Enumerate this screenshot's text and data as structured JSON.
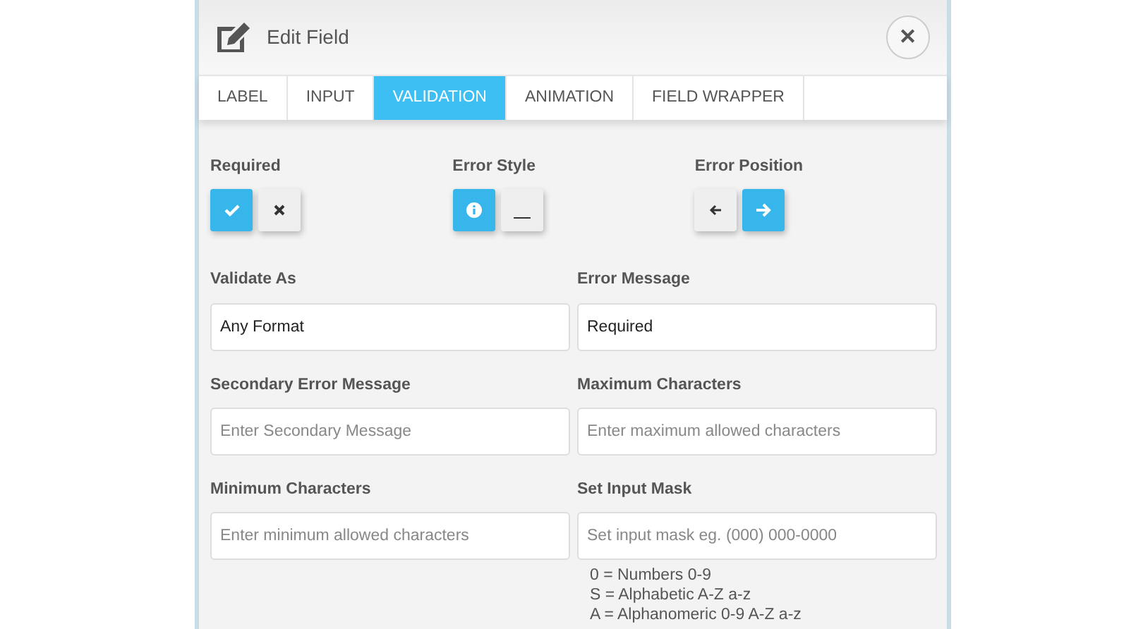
{
  "window": {
    "title": "Edit Field",
    "close": "✕"
  },
  "tabs": [
    {
      "label": "LABEL",
      "selected": false
    },
    {
      "label": "INPUT",
      "selected": false
    },
    {
      "label": "VALIDATION",
      "selected": true
    },
    {
      "label": "ANIMATION",
      "selected": false
    },
    {
      "label": "FIELD WRAPPER",
      "selected": false
    }
  ],
  "toggle_groups": [
    {
      "label": "Required",
      "options": [
        {
          "kind": "check",
          "selected": true
        },
        {
          "kind": "cross",
          "selected": false
        }
      ]
    },
    {
      "label": "Error Style",
      "options": [
        {
          "kind": "info",
          "selected": true
        },
        {
          "kind": "underline",
          "selected": false
        }
      ]
    },
    {
      "label": "Error Position",
      "options": [
        {
          "kind": "left",
          "selected": false
        },
        {
          "kind": "right",
          "selected": true
        }
      ]
    }
  ],
  "fields": [
    {
      "label": "Validate As",
      "value": "Any Format"
    },
    {
      "label": "Error Message",
      "value": "Required"
    },
    {
      "label": "Secondary Error Message",
      "placeholder": "Enter Secondary Message"
    },
    {
      "label": "Maximum Characters",
      "placeholder": "Enter maximum allowed characters"
    },
    {
      "label": "Minimum Characters",
      "placeholder": "Enter minimum allowed characters"
    },
    {
      "label": "Set Input Mask",
      "placeholder": "Set input mask eg. (000) 000-0000",
      "hints": [
        "0 = Numbers 0-9",
        "S = Alphabetic A-Z a-z",
        "A = Alphanomeric 0-9 A-Z a-z"
      ]
    }
  ]
}
